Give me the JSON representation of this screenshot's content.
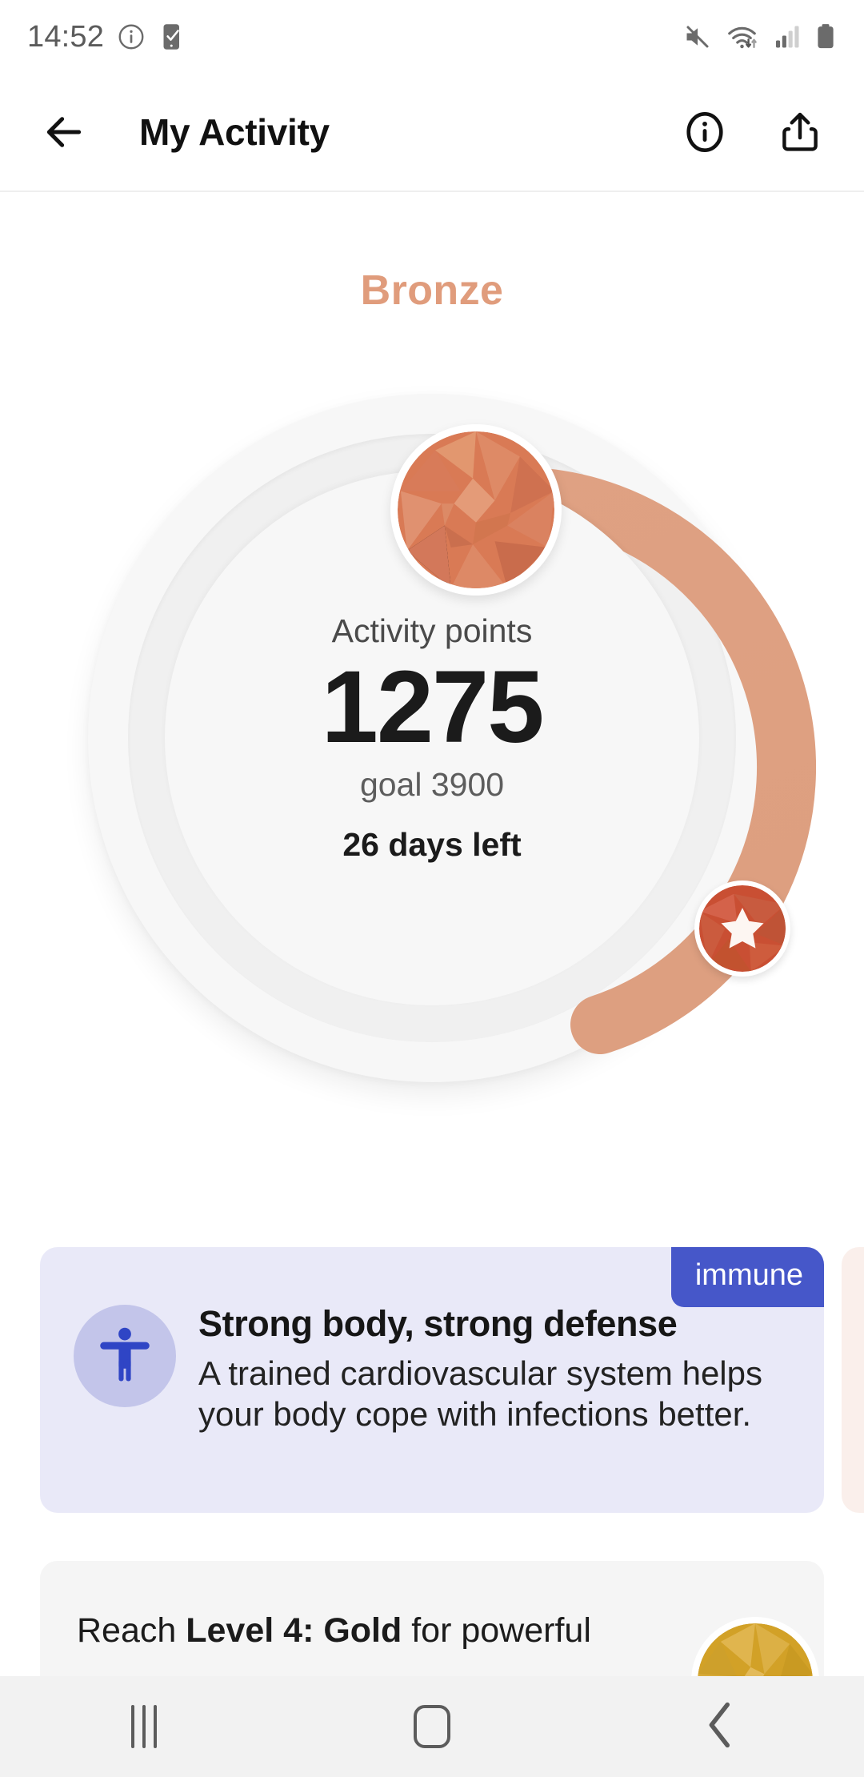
{
  "statusbar": {
    "time": "14:52",
    "icons": [
      "info-circle-icon",
      "device-check-icon",
      "mute-icon",
      "wifi-icon",
      "signal-icon",
      "battery-icon"
    ]
  },
  "header": {
    "back_label": "back-arrow",
    "title": "My Activity",
    "info_label": "info-icon",
    "share_label": "share-icon"
  },
  "progress": {
    "level_name": "Bronze",
    "level_color": "#E09C7C",
    "points_label": "Activity points",
    "points_value": "1275",
    "goal_text": "goal 3900",
    "days_left": "26 days left",
    "arc_color": "#E0A183",
    "track_color": "#F0F0F0",
    "medal_top": "bronze-gem-medal",
    "star_badge": "star-milestone-badge"
  },
  "cards": [
    {
      "badge": "immune",
      "badge_color": "#4657C9",
      "background": "#E9E9F8",
      "icon": "accessibility-icon",
      "title": "Strong body, strong defense",
      "text": "A trained cardiovascular system helps your body cope with infections better."
    }
  ],
  "level_card": {
    "prefix": "Reach ",
    "level": "Level 4: Gold",
    "suffix": " for powerful",
    "medal": "gold-gem-medal"
  },
  "navbar": {
    "recents": "recents-button",
    "home": "home-button",
    "back": "back-button"
  }
}
